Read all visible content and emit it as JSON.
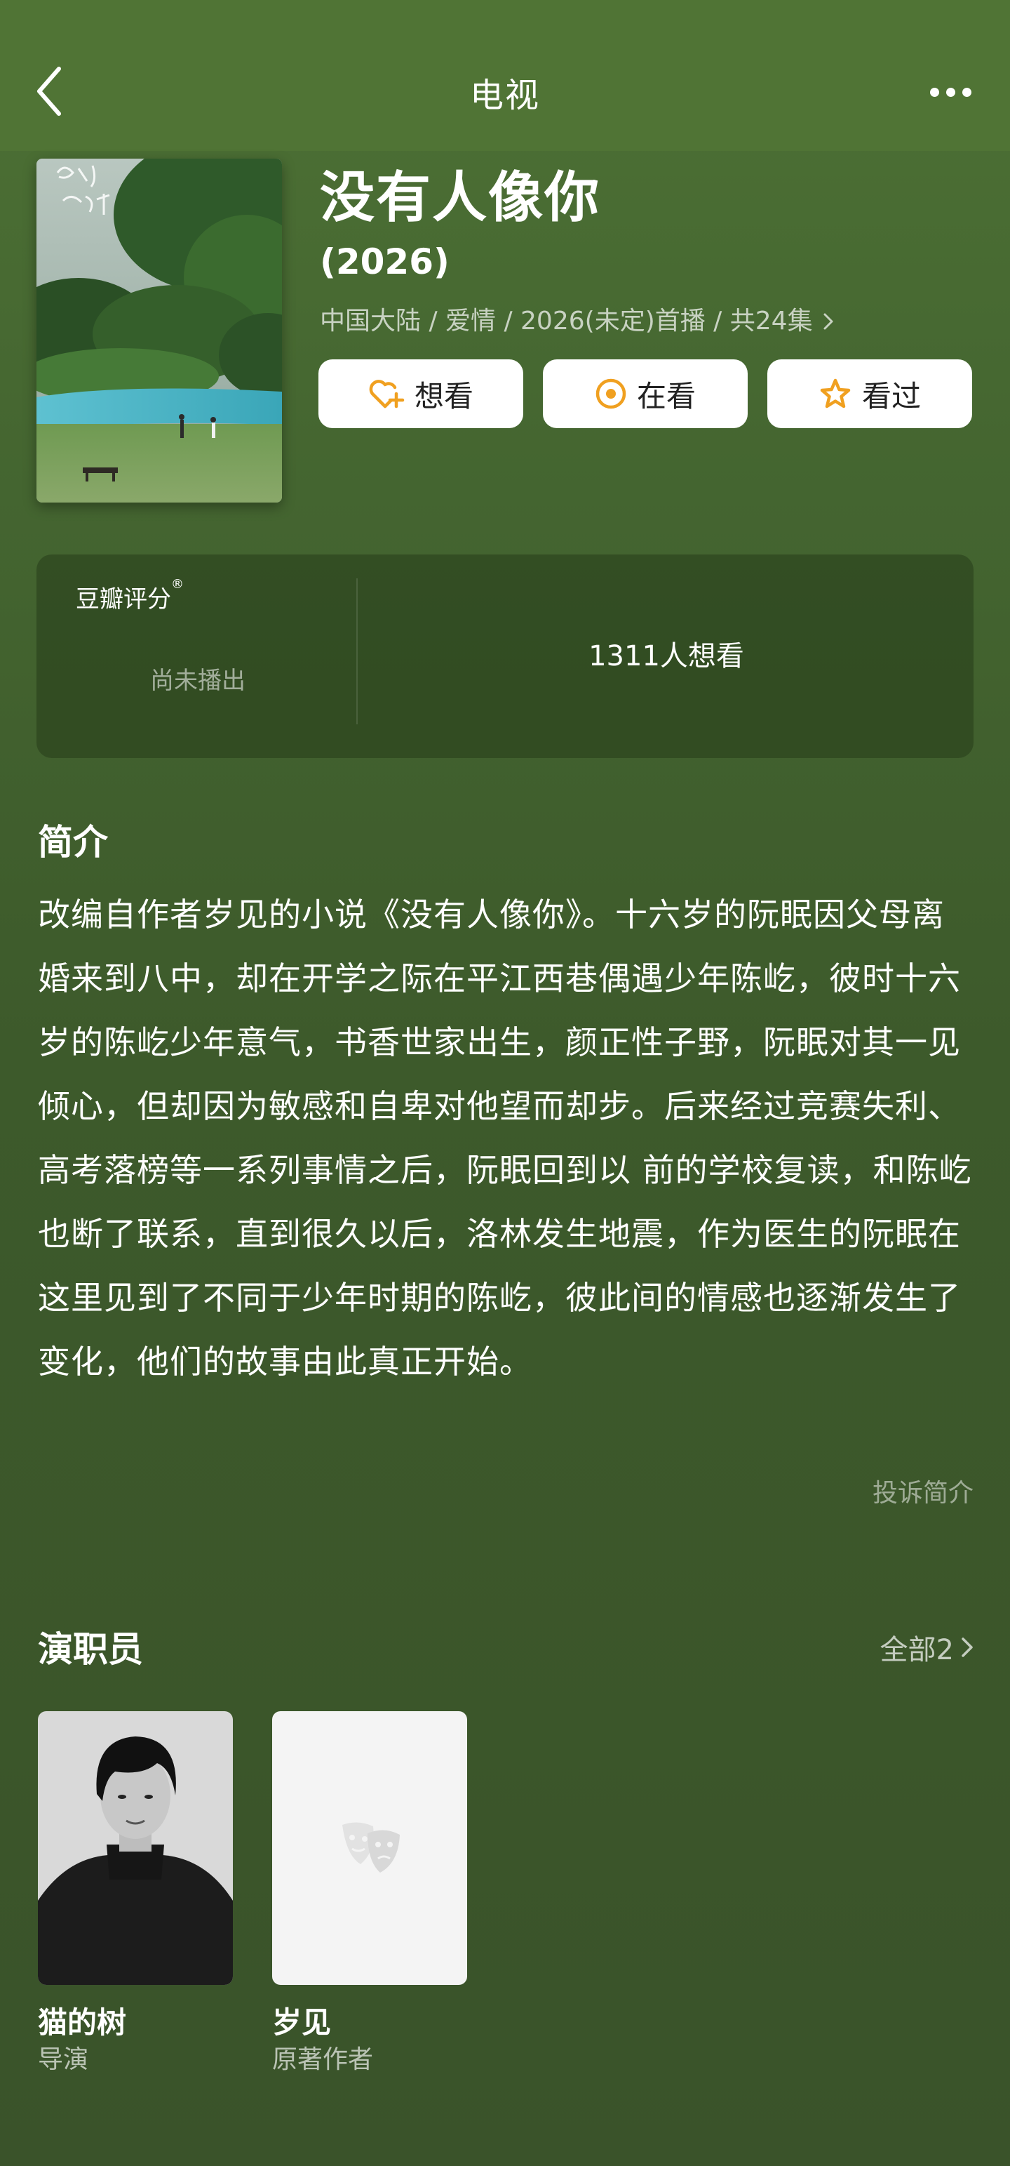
{
  "header": {
    "title": "电视"
  },
  "subject": {
    "title": "没有人像你",
    "year": "(2026)",
    "meta": "中国大陆 / 爱情 / 2026(未定)首播 / 共24集"
  },
  "actions": [
    {
      "label": "想看",
      "icon": "heart-plus-icon"
    },
    {
      "label": "在看",
      "icon": "target-circle-icon"
    },
    {
      "label": "看过",
      "icon": "star-icon"
    }
  ],
  "rating": {
    "label": "豆瓣评分",
    "trademark": "®",
    "status": "尚未播出",
    "wish_count": "1311人想看"
  },
  "synopsis": {
    "title": "简介",
    "text": "改编自作者岁见的小说《没有人像你》。十六岁的阮眠因父母离婚来到八中，却在开学之际在平江西巷偶遇少年陈屹，彼时十六岁的陈屹少年意气，书香世家出生，颜正性子野，阮眠对其一见倾心，但却因为敏感和自卑对他望而却步。后来经过竞赛失利、高考落榜等一系列事情之后，阮眠回到以 前的学校复读，和陈屹也断了联系，直到很久以后，洛林发生地震，作为医生的阮眠在这里见到了不同于少年时期的陈屹，彼此间的情感也逐渐发生了变化，他们的故事由此真正开始。",
    "report": "投诉简介"
  },
  "cast": {
    "title": "演职员",
    "all_label": "全部2",
    "members": [
      {
        "name": "猫的树",
        "role": "导演"
      },
      {
        "name": "岁见",
        "role": "原著作者"
      }
    ]
  },
  "colors": {
    "accent_orange": "#f0a020",
    "nav_bg": "#507435",
    "card_bg": "#2f4a22"
  }
}
